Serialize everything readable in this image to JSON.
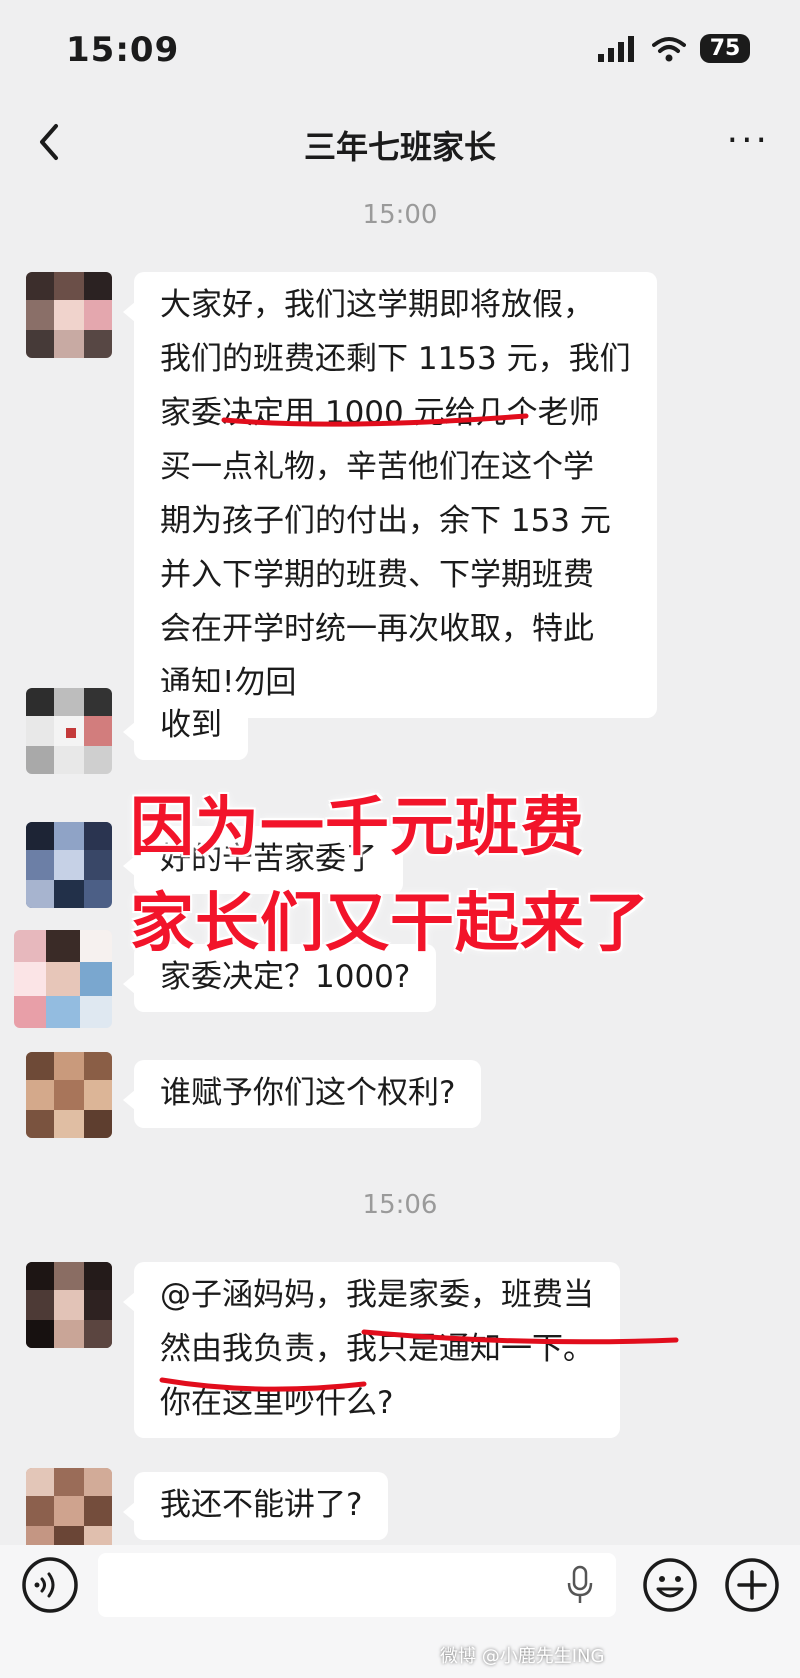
{
  "status_bar": {
    "time": "15:09",
    "battery": "75"
  },
  "header": {
    "title": "三年七班家长"
  },
  "timestamps": [
    "15:00",
    "15:06"
  ],
  "messages": [
    {
      "lines": [
        "大家好，我们这学期即将放假，",
        "我们的班费还剩下 1153 元，我们",
        "家委决定用 1000 元给几个老师",
        "买一点礼物，辛苦他们在这个学",
        "期为孩子们的付出，余下 153 元",
        "并入下学期的班费、下学期班费",
        "会在开学时统一再次收取，特此",
        "通知!勿回"
      ]
    },
    {
      "lines": [
        "收到"
      ]
    },
    {
      "lines": [
        "好的辛苦家委了"
      ]
    },
    {
      "lines": [
        "家委决定？1000?"
      ]
    },
    {
      "lines": [
        "谁赋予你们这个权利?"
      ]
    },
    {
      "lines": [
        "@子涵妈妈，我是家委，班费当",
        "然由我负责，我只是通知一下。",
        "你在这里吵什么?"
      ]
    },
    {
      "lines": [
        "我还不能讲了?"
      ]
    }
  ],
  "overlay": {
    "line1": "因为一千元班费",
    "line2": "家长们又干起来了"
  },
  "watermark": "微博 @小鹿先生ING",
  "colors": {
    "background": "#efeff0",
    "bubble": "#ffffff",
    "annotation_red": "#e10d1c",
    "overlay_red": "#f2142a"
  }
}
